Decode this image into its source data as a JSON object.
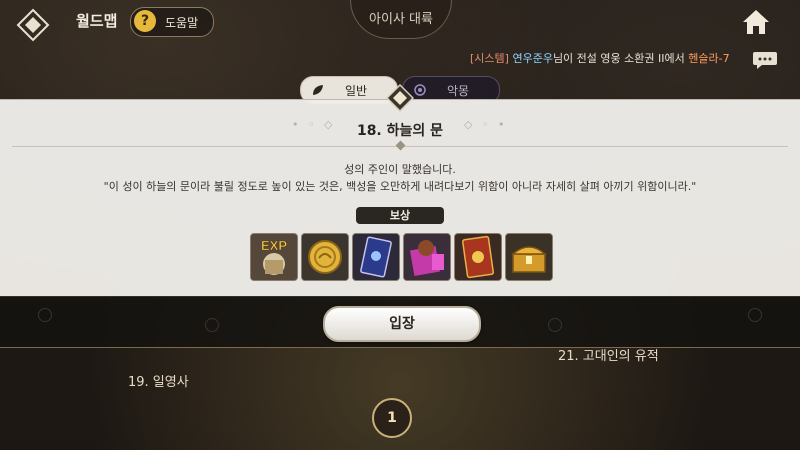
{
  "header": {
    "title": "월드맵",
    "help_label": "도움말",
    "help_glyph": "?",
    "continent": "아이사 대륙",
    "back_icon": "back-diamond-icon",
    "home_icon": "home-icon"
  },
  "system_message": {
    "tag": "[시스템]",
    "player": "연우준우",
    "text_mid": "님이 전설 영웅 소환권 II에서 ",
    "item": "헨슬라-7"
  },
  "tabs": [
    {
      "label": "일반",
      "selected": true,
      "icon": "leaf-icon"
    },
    {
      "label": "악몽",
      "selected": false,
      "icon": "nightmare-icon"
    }
  ],
  "stage": {
    "title": "18. 하늘의 문",
    "description_line1": "성의 주인이 말했습니다.",
    "description_line2": "\"이 성이 하늘의 문이라 불릴 정도로 높이 있는 것은, 백성을 오만하게 내려다보기 위함이 아니라 자세히 살펴 아끼기 위함이니라.\""
  },
  "rewards": {
    "label": "보상",
    "items": [
      {
        "name": "exp-icon",
        "text": "EXP"
      },
      {
        "name": "gold-coin-icon"
      },
      {
        "name": "card-icon"
      },
      {
        "name": "hero-pack-icon"
      },
      {
        "name": "rune-card-icon"
      },
      {
        "name": "treasure-chest-icon"
      }
    ]
  },
  "enter_button": {
    "label": "입장"
  },
  "map": {
    "label_19": "19. 일영사",
    "label_21": "21. 고대인의 유적",
    "page": "1"
  },
  "colors": {
    "accent": "#e6b93c",
    "panel": "#eeece8",
    "system_tag": "#e58d6e",
    "player_name": "#8fd7ff",
    "item_name": "#ff9e5c"
  }
}
